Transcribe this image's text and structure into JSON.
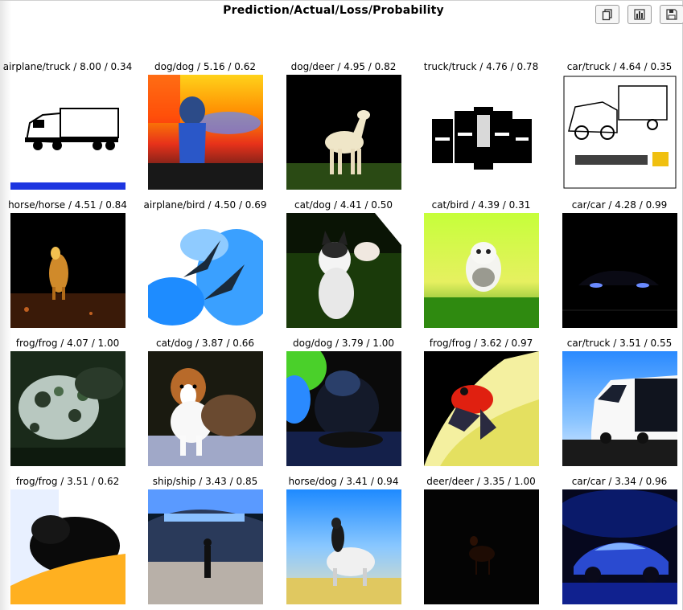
{
  "figure": {
    "title": "Prediction/Actual/Loss/Probability"
  },
  "toolbar": {
    "buttons": [
      {
        "name": "copy-button",
        "icon": "copy-icon"
      },
      {
        "name": "chart-button",
        "icon": "bar-chart-icon"
      },
      {
        "name": "save-button",
        "icon": "floppy-disk-icon"
      }
    ]
  },
  "chart_data": {
    "type": "image-grid",
    "title": "Prediction/Actual/Loss/Probability",
    "rows": 4,
    "cols": 5,
    "cells": [
      {
        "label": "airplane/truck / 8.00 / 0.34",
        "prediction": "airplane",
        "actual": "truck",
        "loss": 8.0,
        "probability": 0.34,
        "image": "truck-line-drawing"
      },
      {
        "label": "dog/dog / 5.16 / 0.62",
        "prediction": "dog",
        "actual": "dog",
        "loss": 5.16,
        "probability": 0.62,
        "image": "dog-sunset"
      },
      {
        "label": "dog/deer / 4.95 / 0.82",
        "prediction": "dog",
        "actual": "deer",
        "loss": 4.95,
        "probability": 0.82,
        "image": "white-deer"
      },
      {
        "label": "truck/truck / 4.76 / 0.78",
        "prediction": "truck",
        "actual": "truck",
        "loss": 4.76,
        "probability": 0.78,
        "image": "trucks-front"
      },
      {
        "label": "car/truck / 4.64 / 0.35",
        "prediction": "car",
        "actual": "truck",
        "loss": 4.64,
        "probability": 0.35,
        "image": "truck-sketch"
      },
      {
        "label": "horse/horse / 4.51 / 0.84",
        "prediction": "horse",
        "actual": "horse",
        "loss": 4.51,
        "probability": 0.84,
        "image": "horse-dark"
      },
      {
        "label": "airplane/bird / 4.50 / 0.69",
        "prediction": "airplane",
        "actual": "bird",
        "loss": 4.5,
        "probability": 0.69,
        "image": "birds-sky"
      },
      {
        "label": "cat/dog / 4.41 / 0.50",
        "prediction": "cat",
        "actual": "dog",
        "loss": 4.41,
        "probability": 0.5,
        "image": "husky-grass"
      },
      {
        "label": "cat/bird / 4.39 / 0.31",
        "prediction": "cat",
        "actual": "bird",
        "loss": 4.39,
        "probability": 0.31,
        "image": "owl-grass"
      },
      {
        "label": "car/car / 4.28 / 0.99",
        "prediction": "car",
        "actual": "car",
        "loss": 4.28,
        "probability": 0.99,
        "image": "car-dark"
      },
      {
        "label": "frog/frog / 4.07 / 1.00",
        "prediction": "frog",
        "actual": "frog",
        "loss": 4.07,
        "probability": 1.0,
        "image": "frog-texture"
      },
      {
        "label": "cat/dog / 3.87 / 0.66",
        "prediction": "cat",
        "actual": "dog",
        "loss": 3.87,
        "probability": 0.66,
        "image": "collie"
      },
      {
        "label": "dog/dog / 3.79 / 1.00",
        "prediction": "dog",
        "actual": "dog",
        "loss": 3.79,
        "probability": 1.0,
        "image": "black-dog"
      },
      {
        "label": "frog/frog / 3.62 / 0.97",
        "prediction": "frog",
        "actual": "frog",
        "loss": 3.62,
        "probability": 0.97,
        "image": "red-frog-leaf"
      },
      {
        "label": "car/truck / 3.51 / 0.55",
        "prediction": "car",
        "actual": "truck",
        "loss": 3.51,
        "probability": 0.55,
        "image": "white-truck"
      },
      {
        "label": "frog/frog / 3.51 / 0.62",
        "prediction": "frog",
        "actual": "frog",
        "loss": 3.51,
        "probability": 0.62,
        "image": "frog-hand"
      },
      {
        "label": "ship/ship / 3.43 / 0.85",
        "prediction": "ship",
        "actual": "ship",
        "loss": 3.43,
        "probability": 0.85,
        "image": "ship-dock"
      },
      {
        "label": "horse/dog / 3.41 / 0.94",
        "prediction": "horse",
        "actual": "dog",
        "loss": 3.41,
        "probability": 0.94,
        "image": "afghan-hound"
      },
      {
        "label": "deer/deer / 3.35 / 1.00",
        "prediction": "deer",
        "actual": "deer",
        "loss": 3.35,
        "probability": 1.0,
        "image": "deer-dark"
      },
      {
        "label": "car/car / 3.34 / 0.96",
        "prediction": "car",
        "actual": "car",
        "loss": 3.34,
        "probability": 0.96,
        "image": "blue-car"
      }
    ]
  }
}
